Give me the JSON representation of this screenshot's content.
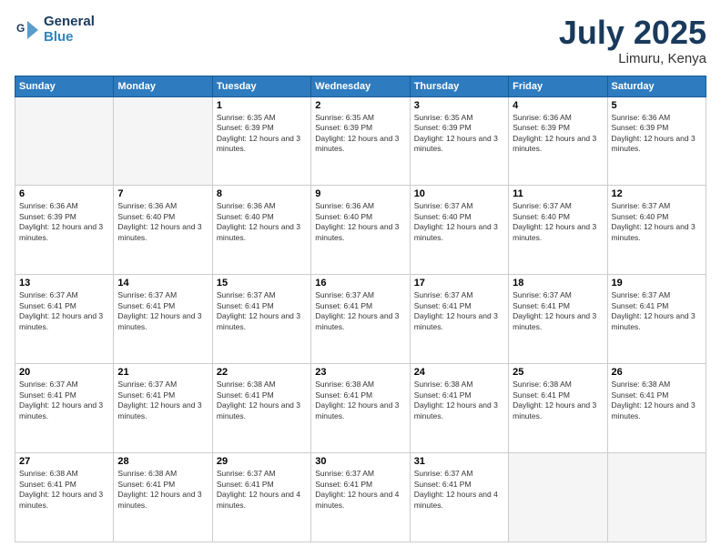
{
  "header": {
    "logo_line1": "General",
    "logo_line2": "Blue",
    "month": "July 2025",
    "location": "Limuru, Kenya"
  },
  "days_of_week": [
    "Sunday",
    "Monday",
    "Tuesday",
    "Wednesday",
    "Thursday",
    "Friday",
    "Saturday"
  ],
  "weeks": [
    [
      {
        "day": "",
        "empty": true
      },
      {
        "day": "",
        "empty": true
      },
      {
        "day": "1",
        "sunrise": "6:35 AM",
        "sunset": "6:39 PM",
        "daylight": "12 hours and 3 minutes."
      },
      {
        "day": "2",
        "sunrise": "6:35 AM",
        "sunset": "6:39 PM",
        "daylight": "12 hours and 3 minutes."
      },
      {
        "day": "3",
        "sunrise": "6:35 AM",
        "sunset": "6:39 PM",
        "daylight": "12 hours and 3 minutes."
      },
      {
        "day": "4",
        "sunrise": "6:36 AM",
        "sunset": "6:39 PM",
        "daylight": "12 hours and 3 minutes."
      },
      {
        "day": "5",
        "sunrise": "6:36 AM",
        "sunset": "6:39 PM",
        "daylight": "12 hours and 3 minutes."
      }
    ],
    [
      {
        "day": "6",
        "sunrise": "6:36 AM",
        "sunset": "6:39 PM",
        "daylight": "12 hours and 3 minutes."
      },
      {
        "day": "7",
        "sunrise": "6:36 AM",
        "sunset": "6:40 PM",
        "daylight": "12 hours and 3 minutes."
      },
      {
        "day": "8",
        "sunrise": "6:36 AM",
        "sunset": "6:40 PM",
        "daylight": "12 hours and 3 minutes."
      },
      {
        "day": "9",
        "sunrise": "6:36 AM",
        "sunset": "6:40 PM",
        "daylight": "12 hours and 3 minutes."
      },
      {
        "day": "10",
        "sunrise": "6:37 AM",
        "sunset": "6:40 PM",
        "daylight": "12 hours and 3 minutes."
      },
      {
        "day": "11",
        "sunrise": "6:37 AM",
        "sunset": "6:40 PM",
        "daylight": "12 hours and 3 minutes."
      },
      {
        "day": "12",
        "sunrise": "6:37 AM",
        "sunset": "6:40 PM",
        "daylight": "12 hours and 3 minutes."
      }
    ],
    [
      {
        "day": "13",
        "sunrise": "6:37 AM",
        "sunset": "6:41 PM",
        "daylight": "12 hours and 3 minutes."
      },
      {
        "day": "14",
        "sunrise": "6:37 AM",
        "sunset": "6:41 PM",
        "daylight": "12 hours and 3 minutes."
      },
      {
        "day": "15",
        "sunrise": "6:37 AM",
        "sunset": "6:41 PM",
        "daylight": "12 hours and 3 minutes."
      },
      {
        "day": "16",
        "sunrise": "6:37 AM",
        "sunset": "6:41 PM",
        "daylight": "12 hours and 3 minutes."
      },
      {
        "day": "17",
        "sunrise": "6:37 AM",
        "sunset": "6:41 PM",
        "daylight": "12 hours and 3 minutes."
      },
      {
        "day": "18",
        "sunrise": "6:37 AM",
        "sunset": "6:41 PM",
        "daylight": "12 hours and 3 minutes."
      },
      {
        "day": "19",
        "sunrise": "6:37 AM",
        "sunset": "6:41 PM",
        "daylight": "12 hours and 3 minutes."
      }
    ],
    [
      {
        "day": "20",
        "sunrise": "6:37 AM",
        "sunset": "6:41 PM",
        "daylight": "12 hours and 3 minutes."
      },
      {
        "day": "21",
        "sunrise": "6:37 AM",
        "sunset": "6:41 PM",
        "daylight": "12 hours and 3 minutes."
      },
      {
        "day": "22",
        "sunrise": "6:38 AM",
        "sunset": "6:41 PM",
        "daylight": "12 hours and 3 minutes."
      },
      {
        "day": "23",
        "sunrise": "6:38 AM",
        "sunset": "6:41 PM",
        "daylight": "12 hours and 3 minutes."
      },
      {
        "day": "24",
        "sunrise": "6:38 AM",
        "sunset": "6:41 PM",
        "daylight": "12 hours and 3 minutes."
      },
      {
        "day": "25",
        "sunrise": "6:38 AM",
        "sunset": "6:41 PM",
        "daylight": "12 hours and 3 minutes."
      },
      {
        "day": "26",
        "sunrise": "6:38 AM",
        "sunset": "6:41 PM",
        "daylight": "12 hours and 3 minutes."
      }
    ],
    [
      {
        "day": "27",
        "sunrise": "6:38 AM",
        "sunset": "6:41 PM",
        "daylight": "12 hours and 3 minutes."
      },
      {
        "day": "28",
        "sunrise": "6:38 AM",
        "sunset": "6:41 PM",
        "daylight": "12 hours and 3 minutes."
      },
      {
        "day": "29",
        "sunrise": "6:37 AM",
        "sunset": "6:41 PM",
        "daylight": "12 hours and 4 minutes."
      },
      {
        "day": "30",
        "sunrise": "6:37 AM",
        "sunset": "6:41 PM",
        "daylight": "12 hours and 4 minutes."
      },
      {
        "day": "31",
        "sunrise": "6:37 AM",
        "sunset": "6:41 PM",
        "daylight": "12 hours and 4 minutes."
      },
      {
        "day": "",
        "empty": true
      },
      {
        "day": "",
        "empty": true
      }
    ]
  ]
}
